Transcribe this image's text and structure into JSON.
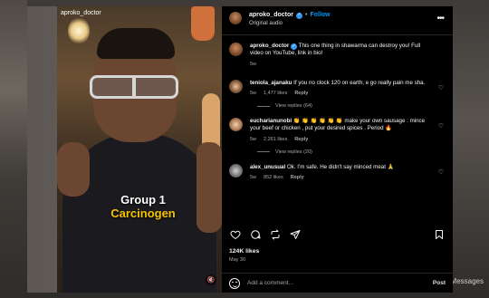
{
  "media": {
    "overlay_username": "aproko_doctor",
    "caption_line1": "Group 1",
    "caption_line2": "Carcinogen"
  },
  "post_header": {
    "username": "aproko_doctor",
    "follow_label": "Follow",
    "audio": "Original audio",
    "more_label": "•••"
  },
  "caption": {
    "username": "aproko_doctor",
    "text": "This one thing in shawarma can destroy you! Full video on YouTube, link in bio!",
    "time": "5w"
  },
  "comments": [
    {
      "username": "teniola_ajanaku",
      "text": "If you no clock 120 on earth, e go really pain me sha.",
      "time": "5w",
      "likes": "1,477 likes",
      "reply": "Reply",
      "view_replies": "View replies (64)"
    },
    {
      "username": "eucharianunobi",
      "text": "👏 👏 👏 👏 👏 👏 make your own sausage : mince your beef or chicken , put your desired spices . Period 🔥",
      "time": "5w",
      "likes": "2,261 likes",
      "reply": "Reply",
      "view_replies": "View replies (20)"
    },
    {
      "username": "alex_unusual",
      "text": "Ok. I'm safe. He didn't say minced meat 🙏",
      "time": "5w",
      "likes": "852 likes",
      "reply": "Reply"
    }
  ],
  "stats": {
    "likes": "124K likes",
    "date": "May 30"
  },
  "add_comment": {
    "placeholder": "Add a comment...",
    "post_label": "Post"
  },
  "background": {
    "messages_label": "Messages"
  },
  "colors": {
    "verified_blue": "#3897f0",
    "follow_blue": "#0095f6",
    "caption_yellow": "#f5c400"
  }
}
